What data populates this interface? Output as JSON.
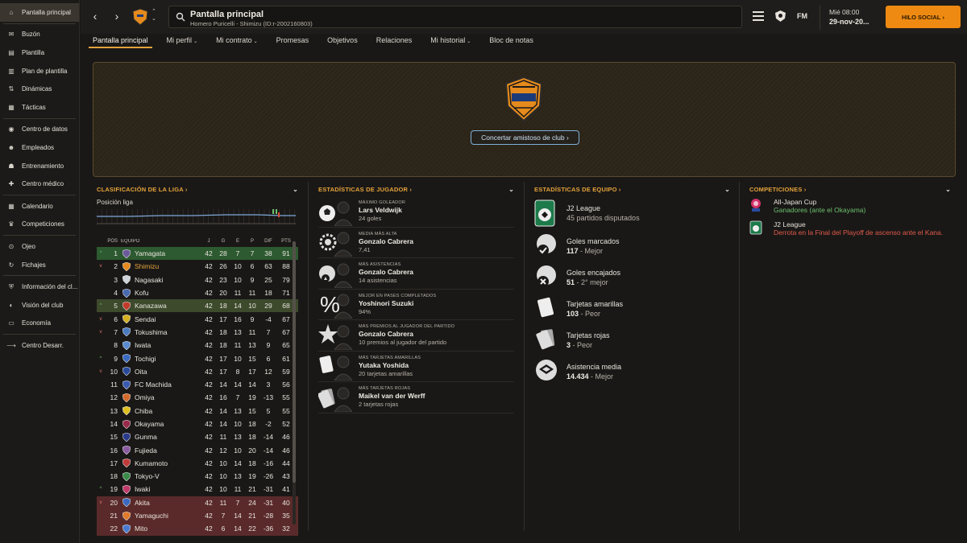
{
  "sidebar": {
    "items": [
      {
        "label": "Pantalla principal",
        "icon": "home-icon",
        "active": true
      },
      {
        "label": "Buzón",
        "icon": "inbox-icon"
      },
      {
        "label": "Plantilla",
        "icon": "squad-icon"
      },
      {
        "label": "Plan de plantilla",
        "icon": "squad-plan-icon"
      },
      {
        "label": "Dinámicas",
        "icon": "dynamics-icon"
      },
      {
        "label": "Tácticas",
        "icon": "tactics-icon"
      },
      {
        "label": "Centro de datos",
        "icon": "data-hub-icon"
      },
      {
        "label": "Empleados",
        "icon": "staff-icon"
      },
      {
        "label": "Entrenamiento",
        "icon": "training-icon"
      },
      {
        "label": "Centro médico",
        "icon": "medical-icon"
      },
      {
        "label": "Calendario",
        "icon": "calendar-icon"
      },
      {
        "label": "Competiciones",
        "icon": "trophy-icon"
      },
      {
        "label": "Ojeo",
        "icon": "scouting-icon"
      },
      {
        "label": "Fichajes",
        "icon": "transfers-icon"
      },
      {
        "label": "Información del cl...",
        "icon": "club-info-icon"
      },
      {
        "label": "Visión del club",
        "icon": "club-vision-icon"
      },
      {
        "label": "Economía",
        "icon": "finances-icon"
      },
      {
        "label": "Centro Desarr.",
        "icon": "dev-centre-icon"
      }
    ]
  },
  "header": {
    "title": "Pantalla principal",
    "subtitle": "Homero Puricelli - Shimizu (ID:r-2002160803)",
    "fm_label": "FM",
    "day": "Mié 08:00",
    "date": "29-nov-20...",
    "social_button": "HILO SOCIAL",
    "social_arrow": "›"
  },
  "tabs": [
    {
      "label": "Pantalla principal",
      "active": true,
      "dropdown": false
    },
    {
      "label": "Mi perfil",
      "dropdown": true
    },
    {
      "label": "Mi contrato",
      "dropdown": true
    },
    {
      "label": "Promesas",
      "dropdown": false
    },
    {
      "label": "Objetivos",
      "dropdown": false
    },
    {
      "label": "Relaciones",
      "dropdown": false
    },
    {
      "label": "Mi historial",
      "dropdown": true
    },
    {
      "label": "Bloc de notas",
      "dropdown": false
    }
  ],
  "hero": {
    "friendly_button": "Concertar amistoso de club ›"
  },
  "league": {
    "heading": "CLASIFICACIÓN DE LA LIGA ›",
    "position_label": "Posición liga",
    "columns": [
      "POS",
      "EQUIPO",
      "J",
      "G",
      "E",
      "P",
      "DIF",
      "PTS"
    ],
    "rows": [
      {
        "mv": "^",
        "pos": "1",
        "team": "Yamagata",
        "j": "42",
        "g": "28",
        "e": "7",
        "p": "7",
        "dif": "38",
        "pts": "91",
        "zone": "promo",
        "crest": "#6a5a9a"
      },
      {
        "mv": "v",
        "pos": "2",
        "team": "Shimizu",
        "j": "42",
        "g": "26",
        "e": "10",
        "p": "6",
        "dif": "63",
        "pts": "88",
        "zone": "",
        "crest": "#e58a1c",
        "highlight": true
      },
      {
        "mv": "",
        "pos": "3",
        "team": "Nagasaki",
        "j": "42",
        "g": "23",
        "e": "10",
        "p": "9",
        "dif": "25",
        "pts": "79",
        "zone": "",
        "crest": "#cfd4da"
      },
      {
        "mv": "",
        "pos": "4",
        "team": "Kofu",
        "j": "42",
        "g": "20",
        "e": "11",
        "p": "11",
        "dif": "18",
        "pts": "71",
        "zone": "",
        "crest": "#4a6ab0"
      },
      {
        "mv": "^",
        "pos": "5",
        "team": "Kanazawa",
        "j": "42",
        "g": "18",
        "e": "14",
        "p": "10",
        "dif": "29",
        "pts": "68",
        "zone": "playoff",
        "crest": "#c23a2a"
      },
      {
        "mv": "v",
        "pos": "6",
        "team": "Sendai",
        "j": "42",
        "g": "17",
        "e": "16",
        "p": "9",
        "dif": "-4",
        "pts": "67",
        "zone": "",
        "crest": "#d4b020"
      },
      {
        "mv": "v",
        "pos": "7",
        "team": "Tokushima",
        "j": "42",
        "g": "18",
        "e": "13",
        "p": "11",
        "dif": "7",
        "pts": "67",
        "zone": "",
        "crest": "#4a7ac0"
      },
      {
        "mv": "",
        "pos": "8",
        "team": "Iwata",
        "j": "42",
        "g": "18",
        "e": "11",
        "p": "13",
        "dif": "9",
        "pts": "65",
        "zone": "",
        "crest": "#5a8ad0"
      },
      {
        "mv": "^",
        "pos": "9",
        "team": "Tochigi",
        "j": "42",
        "g": "17",
        "e": "10",
        "p": "15",
        "dif": "6",
        "pts": "61",
        "zone": "",
        "crest": "#3a6ac0"
      },
      {
        "mv": "v",
        "pos": "10",
        "team": "Oita",
        "j": "42",
        "g": "17",
        "e": "8",
        "p": "17",
        "dif": "12",
        "pts": "59",
        "zone": "",
        "crest": "#2a4a9a"
      },
      {
        "mv": "",
        "pos": "11",
        "team": "FC Machida",
        "j": "42",
        "g": "14",
        "e": "14",
        "p": "14",
        "dif": "3",
        "pts": "56",
        "zone": "",
        "crest": "#3a5ab0"
      },
      {
        "mv": "",
        "pos": "12",
        "team": "Omiya",
        "j": "42",
        "g": "16",
        "e": "7",
        "p": "19",
        "dif": "-13",
        "pts": "55",
        "zone": "",
        "crest": "#d46a2a"
      },
      {
        "mv": "",
        "pos": "13",
        "team": "Chiba",
        "j": "42",
        "g": "14",
        "e": "13",
        "p": "15",
        "dif": "5",
        "pts": "55",
        "zone": "",
        "crest": "#e0c020"
      },
      {
        "mv": "",
        "pos": "14",
        "team": "Okayama",
        "j": "42",
        "g": "14",
        "e": "10",
        "p": "18",
        "dif": "-2",
        "pts": "52",
        "zone": "",
        "crest": "#9a2a4a"
      },
      {
        "mv": "",
        "pos": "15",
        "team": "Gunma",
        "j": "42",
        "g": "11",
        "e": "13",
        "p": "18",
        "dif": "-14",
        "pts": "46",
        "zone": "",
        "crest": "#2a3a8a"
      },
      {
        "mv": "",
        "pos": "16",
        "team": "Fujieda",
        "j": "42",
        "g": "12",
        "e": "10",
        "p": "20",
        "dif": "-14",
        "pts": "46",
        "zone": "",
        "crest": "#8a5aa0"
      },
      {
        "mv": "",
        "pos": "17",
        "team": "Kumamoto",
        "j": "42",
        "g": "10",
        "e": "14",
        "p": "18",
        "dif": "-16",
        "pts": "44",
        "zone": "",
        "crest": "#c03a3a"
      },
      {
        "mv": "",
        "pos": "18",
        "team": "Tokyo-V",
        "j": "42",
        "g": "10",
        "e": "13",
        "p": "19",
        "dif": "-26",
        "pts": "43",
        "zone": "",
        "crest": "#3a8a4a"
      },
      {
        "mv": "^",
        "pos": "19",
        "team": "Iwaki",
        "j": "42",
        "g": "10",
        "e": "11",
        "p": "21",
        "dif": "-31",
        "pts": "41",
        "zone": "",
        "crest": "#c03a6a"
      },
      {
        "mv": "v",
        "pos": "20",
        "team": "Akita",
        "j": "42",
        "g": "11",
        "e": "7",
        "p": "24",
        "dif": "-31",
        "pts": "40",
        "zone": "releg",
        "crest": "#3a6ac0"
      },
      {
        "mv": "",
        "pos": "21",
        "team": "Yamaguchi",
        "j": "42",
        "g": "7",
        "e": "14",
        "p": "21",
        "dif": "-28",
        "pts": "35",
        "zone": "releg",
        "crest": "#e07a2a"
      },
      {
        "mv": "",
        "pos": "22",
        "team": "Mito",
        "j": "42",
        "g": "6",
        "e": "14",
        "p": "22",
        "dif": "-36",
        "pts": "32",
        "zone": "releg",
        "crest": "#4a7ad0"
      }
    ]
  },
  "player_stats": {
    "heading": "ESTADÍSTICAS DE JUGADOR ›",
    "rows": [
      {
        "cat": "MÁXIMO GOLEADOR",
        "name": "Lars Veldwijk",
        "val": "24 goles",
        "icon": "ball-icon"
      },
      {
        "cat": "MEDIA MÁS ALTA",
        "name": "Gonzalo Cabrera",
        "val": "7,41",
        "icon": "rating-icon"
      },
      {
        "cat": "MÁS ASISTENCIAS",
        "name": "Gonzalo Cabrera",
        "val": "14 asistencias",
        "icon": "assist-icon"
      },
      {
        "cat": "MEJOR EN PASES COMPLETADOS",
        "name": "Yoshinori Suzuki",
        "val": "94%",
        "icon": "percent-icon"
      },
      {
        "cat": "MÁS PREMIOS AL JUGADOR DEL PARTIDO",
        "name": "Gonzalo Cabrera",
        "val": "10 premios al jugador del partido",
        "icon": "star-icon"
      },
      {
        "cat": "MÁS TARJETAS AMARILLAS",
        "name": "Yutaka Yoshida",
        "val": "20 tarjetas amarillas",
        "icon": "yellow-card-icon"
      },
      {
        "cat": "MÁS TARJETAS ROJAS",
        "name": "Maikel van der Werff",
        "val": "2 tarjetas rojas",
        "icon": "red-card-icon"
      }
    ]
  },
  "team_stats": {
    "heading": "ESTADÍSTICAS DE EQUIPO ›",
    "rows": [
      {
        "l1": "J2 League",
        "v": "45 partidos disputados",
        "s": "",
        "icon": "j2-league-icon"
      },
      {
        "l1": "Goles marcados",
        "v": "117",
        "s": " - Mejor",
        "icon": "goals-scored-icon"
      },
      {
        "l1": "Goles encajados",
        "v": "51",
        "s": " - 2° mejor",
        "icon": "goals-conceded-icon"
      },
      {
        "l1": "Tarjetas amarillas",
        "v": "103",
        "s": " - Peor",
        "icon": "yellow-cards-icon"
      },
      {
        "l1": "Tarjetas rojas",
        "v": "3",
        "s": " - Peor",
        "icon": "red-cards-icon"
      },
      {
        "l1": "Asistencia media",
        "v": "14.434",
        "s": " - Mejor",
        "icon": "attendance-icon"
      }
    ]
  },
  "competitions": {
    "heading": "COMPETICIONES ›",
    "rows": [
      {
        "name": "All-Japan Cup",
        "result": "Ganadores (ante el Okayama)",
        "color": "#6cc16c",
        "icon": "emperor-cup-icon"
      },
      {
        "name": "J2 League",
        "result": "Derrota en la Final del Playoff de ascenso ante el Kana...",
        "color": "#e05a4a",
        "icon": "j2-league-icon"
      }
    ]
  },
  "colors": {
    "accent": "#e4a33a",
    "social": "#ee8a12",
    "promo": "#2d5a30",
    "releg": "#5a2a2a"
  }
}
